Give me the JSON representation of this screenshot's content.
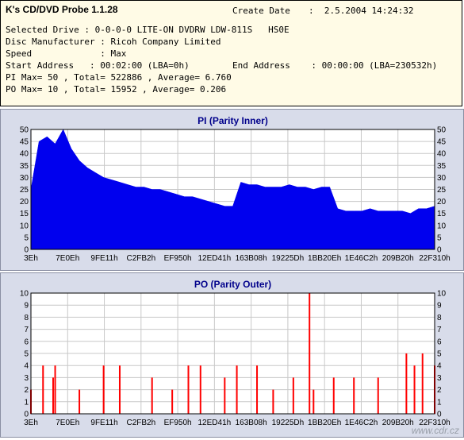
{
  "header": {
    "app_title": "K's CD/DVD Probe 1.1.28",
    "create_date_label": "Create Date",
    "create_date_value": ":  2.5.2004 14:24:32",
    "selected_drive": "Selected Drive : 0-0-0-0 LITE-ON DVDRW LDW-811S   HS0E",
    "disc_manufacturer": "Disc Manufacturer : Ricoh Company Limited",
    "speed": "Speed             : Max",
    "start_address": "Start Address   : 00:02:00 (LBA=0h)",
    "end_address": "End Address    : 00:00:00 (LBA=230532h)",
    "pi_stats": "PI Max= 50 , Total= 522886 , Average= 6.760",
    "po_stats": "PO Max= 10 , Total= 15952 , Average= 0.206"
  },
  "colors": {
    "pi_fill": "#0000ee",
    "po_fill": "#ff0000",
    "plot_bg": "#ffffff",
    "grid": "#c8c8c8",
    "title": "#00008b",
    "panel_bg": "#d8dcea"
  },
  "watermark": "www.cdr.cz",
  "chart_data": [
    {
      "type": "area",
      "title": "PI (Parity Inner)",
      "xlabel": "",
      "ylabel": "",
      "ylim": [
        0,
        50
      ],
      "yticks": [
        0,
        5,
        10,
        15,
        20,
        25,
        30,
        35,
        40,
        45,
        50
      ],
      "grid": true,
      "x_tick_labels": [
        "3Eh",
        "7E0Eh",
        "9FE11h",
        "C2FB2h",
        "EF950h",
        "12ED41h",
        "163B08h",
        "19225Dh",
        "1BB20Eh",
        "1E46C2h",
        "209B20h",
        "22F310h"
      ],
      "series": [
        {
          "x": [
            0,
            0.02,
            0.04,
            0.06,
            0.08,
            0.1,
            0.12,
            0.14,
            0.16,
            0.18,
            0.2,
            0.22,
            0.24,
            0.26,
            0.28,
            0.3,
            0.32,
            0.34,
            0.36,
            0.38,
            0.4,
            0.42,
            0.44,
            0.46,
            0.48,
            0.5,
            0.52,
            0.54,
            0.56,
            0.58,
            0.6,
            0.62,
            0.64,
            0.66,
            0.68,
            0.7,
            0.72,
            0.74,
            0.76,
            0.78,
            0.8,
            0.82,
            0.84,
            0.86,
            0.88,
            0.9,
            0.92,
            0.94,
            0.96,
            0.98,
            1.0
          ],
          "values": [
            25,
            45,
            47,
            44,
            50,
            42,
            37,
            34,
            32,
            30,
            29,
            28,
            27,
            26,
            26,
            25,
            25,
            24,
            23,
            22,
            22,
            21,
            20,
            19,
            18,
            18,
            28,
            27,
            27,
            26,
            26,
            26,
            27,
            26,
            26,
            25,
            26,
            26,
            17,
            16,
            16,
            16,
            17,
            16,
            16,
            16,
            16,
            15,
            17,
            17,
            18
          ]
        }
      ]
    },
    {
      "type": "bar",
      "title": "PO (Parity Outer)",
      "xlabel": "",
      "ylabel": "",
      "ylim": [
        0,
        10
      ],
      "yticks": [
        0,
        1,
        2,
        3,
        4,
        5,
        6,
        7,
        8,
        9,
        10
      ],
      "grid": true,
      "x_tick_labels": [
        "3Eh",
        "7E0Eh",
        "9FE11h",
        "C2FB2h",
        "EF950h",
        "12ED41h",
        "163B08h",
        "19225Dh",
        "1BB20Eh",
        "1E46C2h",
        "209B20h",
        "22F310h"
      ],
      "series": [
        {
          "x": [
            0,
            0.03,
            0.055,
            0.06,
            0.12,
            0.18,
            0.22,
            0.3,
            0.35,
            0.39,
            0.42,
            0.48,
            0.51,
            0.56,
            0.6,
            0.65,
            0.69,
            0.7,
            0.75,
            0.8,
            0.86,
            0.93,
            0.95,
            0.97,
            1.0
          ],
          "values": [
            2,
            4,
            3,
            4,
            2,
            4,
            4,
            3,
            2,
            4,
            4,
            3,
            4,
            4,
            2,
            3,
            10,
            2,
            3,
            3,
            3,
            5,
            4,
            5,
            4
          ]
        }
      ]
    }
  ]
}
